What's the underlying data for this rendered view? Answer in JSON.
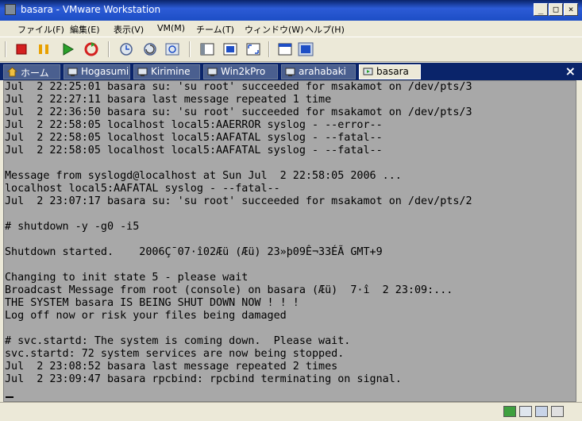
{
  "window": {
    "title": "basara - VMware Workstation",
    "minimize": "_",
    "maximize": "□",
    "close": "×"
  },
  "menu": {
    "items": [
      "ファイル(F)",
      "編集(E)",
      "表示(V)",
      "VM(M)",
      "チーム(T)",
      "ウィンドウ(W)",
      "ヘルプ(H)"
    ]
  },
  "tabs": {
    "items": [
      {
        "label": "ホーム",
        "active": false
      },
      {
        "label": "Hogasumi",
        "active": false
      },
      {
        "label": "Kirimine",
        "active": false
      },
      {
        "label": "Win2kPro",
        "active": false
      },
      {
        "label": "arahabaki",
        "active": false
      },
      {
        "label": "basara",
        "active": true
      }
    ],
    "close_label": "×"
  },
  "console": {
    "lines": [
      "Jul  2 22:25:01 basara su: 'su root' succeeded for msakamot on /dev/pts/3",
      "Jul  2 22:27:11 basara last message repeated 1 time",
      "Jul  2 22:36:50 basara su: 'su root' succeeded for msakamot on /dev/pts/3",
      "Jul  2 22:58:05 localhost local5:AAERROR syslog - --error--",
      "Jul  2 22:58:05 localhost local5:AAFATAL syslog - --fatal--",
      "Jul  2 22:58:05 localhost local5:AAFATAL syslog - --fatal--",
      "",
      "Message from syslogd@localhost at Sun Jul  2 22:58:05 2006 ...",
      "localhost local5:AAFATAL syslog - --fatal--",
      "Jul  2 23:07:17 basara su: 'su root' succeeded for msakamot on /dev/pts/2",
      "",
      "# shutdown -y -g0 -i5",
      "",
      "Shutdown started.    2006Ç¯07·î02Æü (Æü) 23»þ09Ê¬33ÉÃ GMT+9",
      "",
      "Changing to init state 5 - please wait",
      "Broadcast Message from root (console) on basara (Æü)  7·î  2 23:09:...",
      "THE SYSTEM basara IS BEING SHUT DOWN NOW ! ! !",
      "Log off now or risk your files being damaged",
      "",
      "# svc.startd: The system is coming down.  Please wait.",
      "svc.startd: 72 system services are now being stopped.",
      "Jul  2 23:08:52 basara last message repeated 2 times",
      "Jul  2 23:09:47 basara rpcbind: rpcbind terminating on signal."
    ]
  },
  "colors": {
    "titlebar": "#0a246a",
    "console_bg": "#a8a8a8",
    "chrome": "#ece9d8"
  }
}
